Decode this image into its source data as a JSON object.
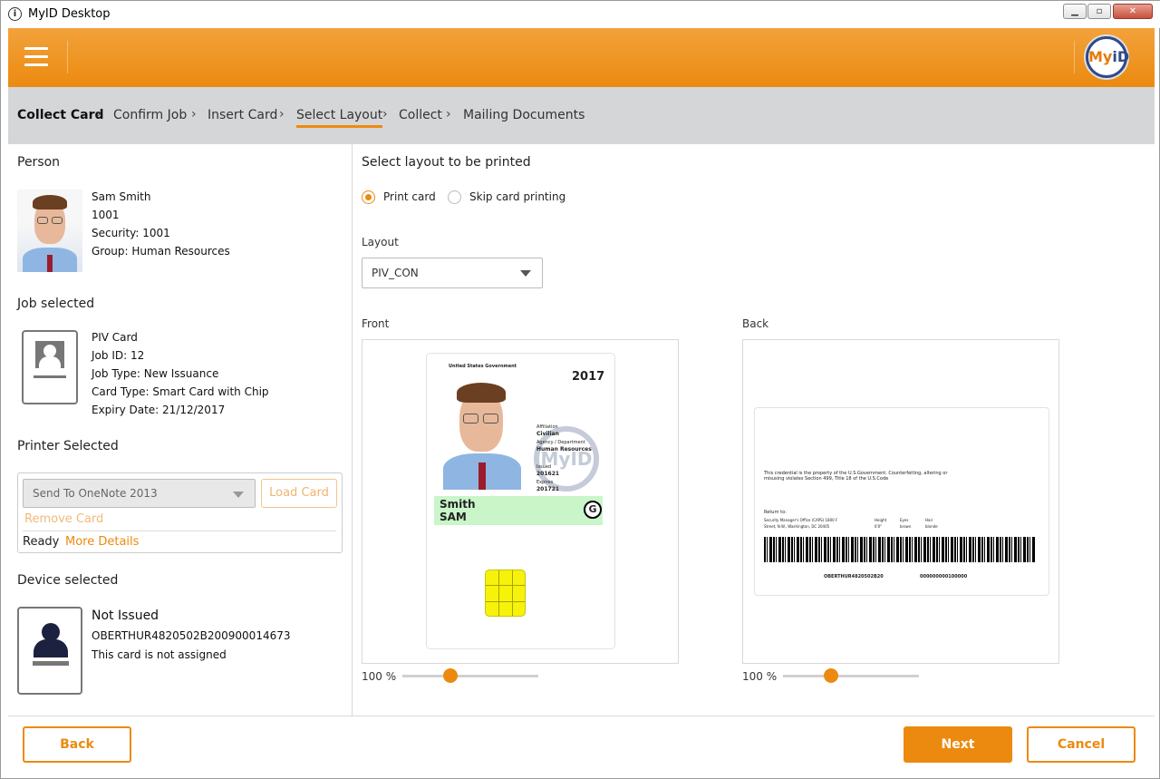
{
  "window": {
    "title": "MyID Desktop",
    "minimize": "▁",
    "maximize": "▫",
    "close": "✕"
  },
  "header": {
    "logo_text_a": "My",
    "logo_text_b": "iD"
  },
  "breadcrumbs": [
    "Collect Card",
    "Confirm Job",
    "Insert Card",
    "Select Layout",
    "Collect",
    "Mailing Documents"
  ],
  "breadcrumb_active": "Select Layout",
  "person": {
    "heading": "Person",
    "name": "Sam Smith",
    "id": "1001",
    "security_label": "Security:",
    "security": "1001",
    "group_label": "Group:",
    "group": "Human Resources"
  },
  "job": {
    "heading": "Job selected",
    "type": "PIV Card",
    "job_id_label": "Job ID:",
    "job_id": "12",
    "job_type_label": "Job Type:",
    "job_type": "New Issuance",
    "card_type_label": "Card Type:",
    "card_type": "Smart Card with Chip",
    "expiry_label": "Expiry Date:",
    "expiry": "21/12/2017"
  },
  "printer": {
    "heading": "Printer Selected",
    "selected": "Send To OneNote 2013",
    "load_card": "Load Card",
    "remove_card": "Remove Card",
    "status": "Ready",
    "more_details": "More Details"
  },
  "device": {
    "heading": "Device selected",
    "status": "Not Issued",
    "serial": "OBERTHUR4820502B200900014673",
    "note": "This card is not assigned"
  },
  "layout_panel": {
    "heading": "Select layout to be printed",
    "option_print": "Print card",
    "option_skip": "Skip card printing",
    "layout_label": "Layout",
    "layout_value": "PIV_CON",
    "front_label": "Front",
    "back_label": "Back",
    "front_zoom": "100 %",
    "back_zoom": "100 %",
    "front_zoom_level": 0.35,
    "back_zoom_level": 0.35
  },
  "card_front": {
    "govt": "United States Government",
    "year": "2017",
    "affiliation_label": "Affiliation",
    "affiliation": "Civilian",
    "agency_label": "Agency / Department",
    "agency": "Human Resources",
    "issued_label": "Issued",
    "issued": "201621",
    "expires_label": "Expires",
    "expires": "201721",
    "surname": "Smith",
    "given": "SAM",
    "badge": "G",
    "watermark": "MyID"
  },
  "card_back": {
    "notice": "This credential is the property of the U.S.Government. Counterfeiting, altering or misusing violates Section 499, Title 18 of the U.S.Code",
    "return_to": "Return to:",
    "address1": "Security Manager's Office (CAPS) 1800 F",
    "address2": "Street, N.W., Washington, DC 20405",
    "height_label": "Height",
    "height": "6'0\"",
    "eyes_label": "Eyes",
    "eyes": "brown",
    "hair_label": "Hair",
    "hair": "blonde",
    "serial": "OBERTHUR4820502B20",
    "number": "000000000100000"
  },
  "footer": {
    "back": "Back",
    "next": "Next",
    "cancel": "Cancel"
  }
}
